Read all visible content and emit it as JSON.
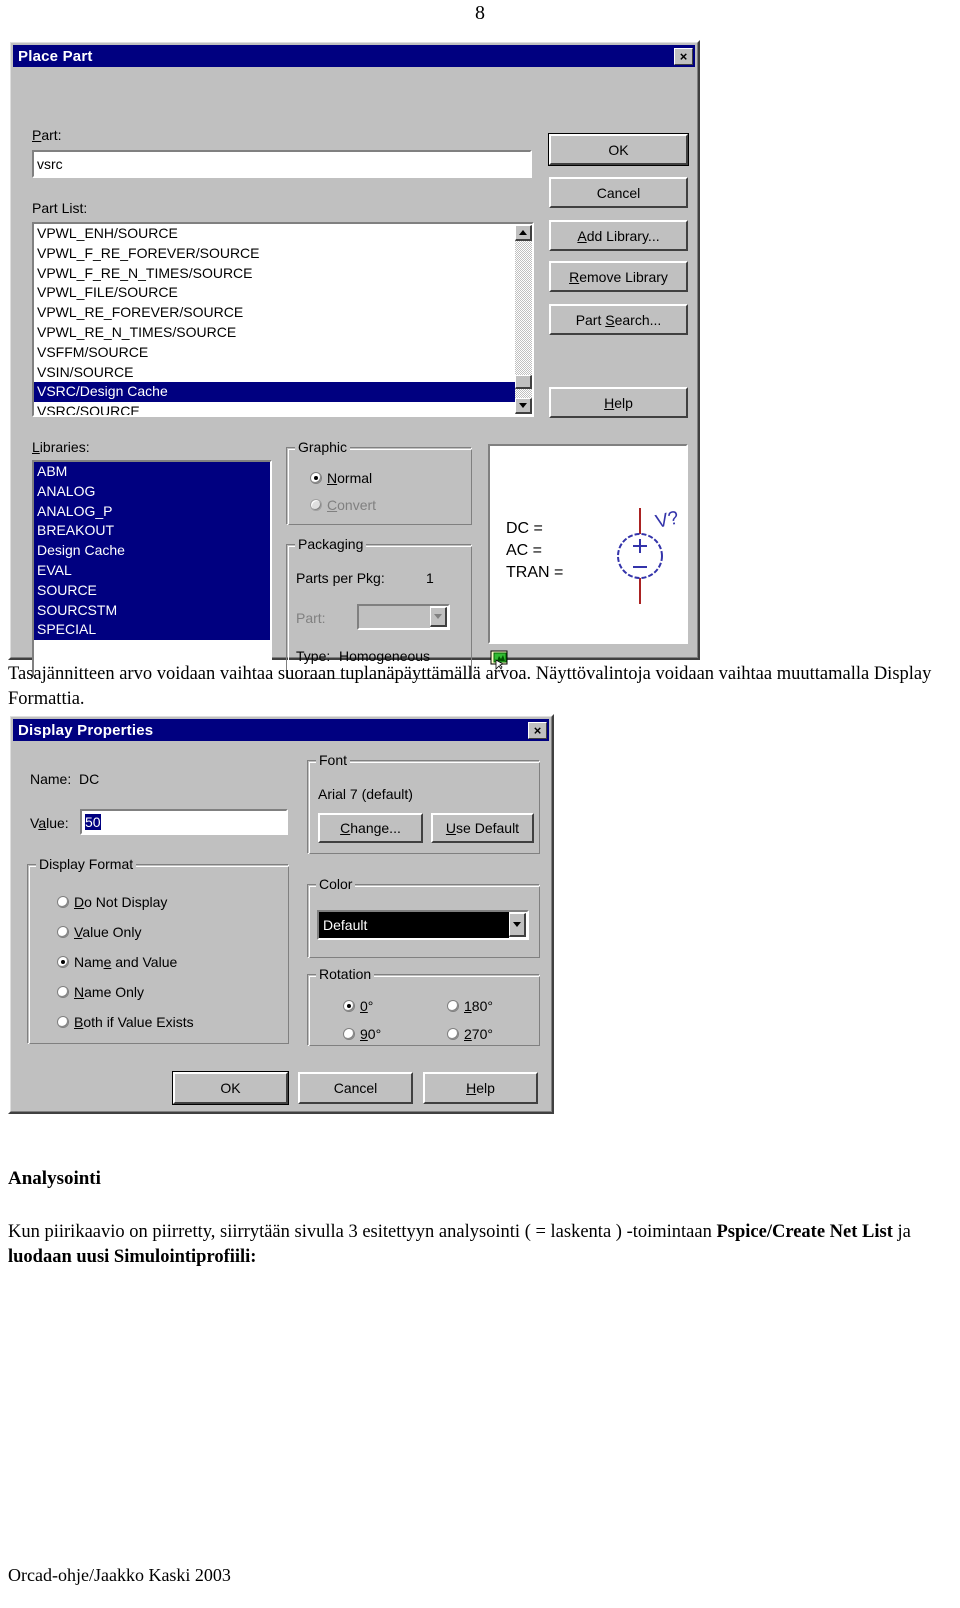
{
  "document": {
    "page_number": "8",
    "paragraph_1": "Tasajännitteen arvo voidaan vaihtaa suoraan tuplanäpäyttämällä arvoa. Näyttövalintoja voidaan vaihtaa muuttamalla Display Formattia.",
    "heading_analysointi": "Analysointi",
    "paragraph_2_part1": "Kun piirikaavio on piirretty, siirrytään sivulla 3  esitettyyn analysointi ( = laskenta ) -toimintaan",
    "paragraph_2_bold1": "Pspice/Create Net List",
    "paragraph_2_mid": " ja ",
    "paragraph_2_bold2": "luodaan uusi Simulointiprofiili:",
    "footer": "Orcad-ohje/Jaakko Kaski 2003"
  },
  "place_part_dialog": {
    "title": "Place Part",
    "close_label": "×",
    "part_label": "Part:",
    "part_label_accel": "P",
    "part_label_rest": "art:",
    "part_value": "vsrc",
    "part_list_label": "Part List:",
    "part_list_items": [
      "VPWL_ENH/SOURCE",
      "VPWL_F_RE_FOREVER/SOURCE",
      "VPWL_F_RE_N_TIMES/SOURCE",
      "VPWL_FILE/SOURCE",
      "VPWL_RE_FOREVER/SOURCE",
      "VPWL_RE_N_TIMES/SOURCE",
      "VSFFM/SOURCE",
      "VSIN/SOURCE",
      "VSRC/Design Cache",
      "VSRC/SOURCE"
    ],
    "part_list_selected_index": 8,
    "libraries_label": "Libraries:",
    "libraries_label_accel": "L",
    "libraries_label_rest": "ibraries:",
    "libraries_items": [
      "ABM",
      "ANALOG",
      "ANALOG_P",
      "BREAKOUT",
      "Design Cache",
      "EVAL",
      "SOURCE",
      "SOURCSTM",
      "SPECIAL"
    ],
    "buttons": [
      {
        "name": "ok",
        "label": "OK",
        "accel": "",
        "label_rest": "OK",
        "default": true,
        "disabled": false
      },
      {
        "name": "cancel",
        "label": "Cancel",
        "accel": "",
        "label_rest": "Cancel",
        "default": false,
        "disabled": false
      },
      {
        "name": "add-library",
        "label": "Add Library...",
        "accel": "A",
        "label_rest": "dd Library...",
        "default": false,
        "disabled": false
      },
      {
        "name": "remove-library",
        "label": "Remove Library",
        "accel": "R",
        "label_rest": "emove Library",
        "default": false,
        "disabled": false
      },
      {
        "name": "part-search",
        "label": "Part Search...",
        "accel": "S",
        "label_pre": "Part ",
        "label_rest": "earch...",
        "default": false,
        "disabled": false
      },
      {
        "name": "help",
        "label": "Help",
        "accel": "H",
        "label_rest": "elp",
        "default": false,
        "disabled": false
      }
    ],
    "graphic_group": {
      "title": "Graphic",
      "options": [
        {
          "label": "Normal",
          "accel": "N",
          "label_rest": "ormal",
          "selected": true,
          "disabled": false
        },
        {
          "label": "Convert",
          "accel": "C",
          "label_rest": "onvert",
          "selected": false,
          "disabled": true
        }
      ]
    },
    "packaging_group": {
      "title": "Packaging",
      "title_accel": "g",
      "parts_per_pkg_label": "Parts per Pkg:",
      "parts_per_pkg_value": "1",
      "part_combo_label": "Part:",
      "part_combo_value": "",
      "part_combo_disabled": true,
      "type_label": "Type:",
      "type_value": "Homogeneous"
    },
    "preview": {
      "dc_line": "DC =",
      "ac_line": "AC =",
      "tran_line": "TRAN =",
      "reference_designator": "V?",
      "plus_sign": "+",
      "minus_sign": "–",
      "symbol_body_color": "#3333aa",
      "symbol_lead_color": "#aa2222",
      "icon_name": "picture-select-icon"
    }
  },
  "display_properties_dialog": {
    "title": "Display Properties",
    "close_label": "×",
    "name_label": "Name:",
    "name_value": "DC",
    "value_label": "Value:",
    "value_label_accel": "a",
    "value_label_pre": "V",
    "value_label_rest": "lue:",
    "value_text": "50",
    "value_selected": true,
    "display_format_group": {
      "title": "Display Format",
      "options": [
        {
          "label": "Do Not Display",
          "accel": "D",
          "label_rest": "o Not Display",
          "selected": false
        },
        {
          "label": "Value Only",
          "accel": "V",
          "label_rest": "alue Only",
          "selected": false
        },
        {
          "label": "Name and Value",
          "accel": "e",
          "label_pre": "Nam",
          "label_rest": " and Value",
          "selected": true
        },
        {
          "label": "Name Only",
          "accel": "N",
          "label_rest": "ame Only",
          "selected": false
        },
        {
          "label": "Both if Value Exists",
          "accel": "B",
          "label_rest": "oth if Value Exists",
          "selected": false
        }
      ]
    },
    "font_group": {
      "title": "Font",
      "font_description": "Arial 7 (default)",
      "change_button": "Change...",
      "change_accel": "C",
      "change_rest": "hange...",
      "use_default_button": "Use Default",
      "use_default_accel": "U",
      "use_default_rest": "se Default"
    },
    "color_group": {
      "title": "Color",
      "title_accel": "r",
      "selected_value": "Default"
    },
    "rotation_group": {
      "title": "Rotation",
      "options": [
        {
          "label": "0°",
          "accel": "0",
          "label_rest": "°",
          "selected": true
        },
        {
          "label": "180°",
          "accel": "1",
          "label_rest": "80°",
          "selected": false
        },
        {
          "label": "90°",
          "accel": "9",
          "label_rest": "0°",
          "selected": false
        },
        {
          "label": "270°",
          "accel": "2",
          "label_rest": "70°",
          "selected": false
        }
      ]
    },
    "buttons": [
      {
        "name": "ok",
        "label": "OK",
        "default": true
      },
      {
        "name": "cancel",
        "label": "Cancel",
        "default": false
      },
      {
        "name": "help",
        "label": "Help",
        "accel": "H",
        "label_rest": "elp",
        "default": false
      }
    ]
  },
  "colors": {
    "window_face": "#c0c0c0",
    "titlebar": "#000080",
    "selection": "#000080",
    "selection_text": "#ffffff"
  }
}
